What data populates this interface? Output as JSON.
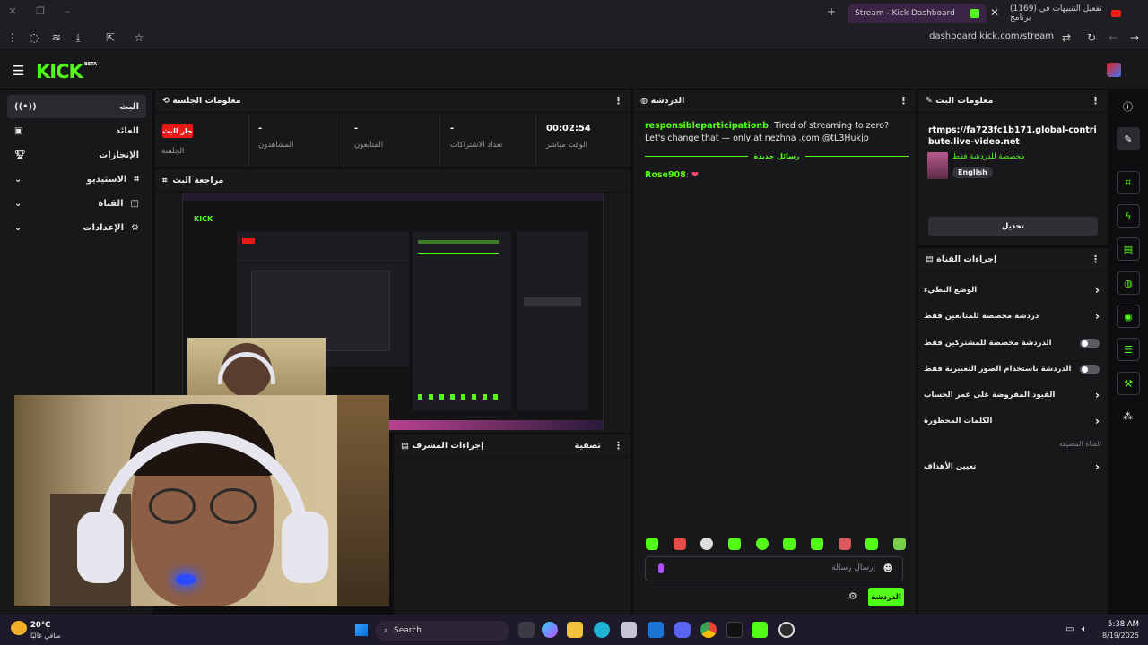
{
  "browser": {
    "tabs": [
      {
        "title": "(1169) تفعيل التنبيهات في برنامج",
        "active": false
      },
      {
        "title": "Stream - Kick Dashboard",
        "active": true
      }
    ],
    "url": "dashboard.kick.com/stream"
  },
  "app": {
    "logo": "KICK",
    "beta": "BETA"
  },
  "nav": [
    {
      "label": "البث",
      "icon": "broadcast-icon",
      "active": true
    },
    {
      "label": "العائد",
      "icon": "money-icon",
      "active": false
    },
    {
      "label": "الإنجازات",
      "icon": "trophy-icon",
      "active": false
    },
    {
      "label": "الاستيديو",
      "icon": "studio-icon",
      "active": false
    },
    {
      "label": "القناة",
      "icon": "channel-icon",
      "active": false
    },
    {
      "label": "الإعدادات",
      "icon": "gear-icon",
      "active": false
    }
  ],
  "session": {
    "title": "معلومات الجلسة",
    "badge": "جار البث",
    "badge_label": "الجلسة",
    "stats": [
      {
        "value": "-",
        "label": "المشاهدون"
      },
      {
        "value": "-",
        "label": "المتابعون"
      },
      {
        "value": "-",
        "label": "تعداد الاشتراكات"
      },
      {
        "value": "00:02:54",
        "label": "الوقت مباشر"
      }
    ]
  },
  "preview": {
    "title": "مراجعة البث"
  },
  "chat": {
    "title": "الدردشة",
    "messages": [
      {
        "user": "responsibleparticipationb",
        "text": ": Tired of streaming to zero? Let's change that — only at nezhna .com @tL3Hukjp"
      },
      {
        "user": "Rose908",
        "text": ": ❤"
      }
    ],
    "separator": "رسائل جديدة",
    "placeholder": "إرسال رسالة",
    "send_label": "الدردشة"
  },
  "mod": {
    "title": "إجراءات المشرف",
    "filter": "تصفية"
  },
  "stream_info": {
    "title": "معلومات البث",
    "url": "rtmps://fa723fc1b171.global-contribute.live-video.net",
    "category": "مخصصة للدردشة فقط",
    "language": "English",
    "edit_label": "تحديل"
  },
  "channel_actions": {
    "title": "إجراءات القناة",
    "rows": [
      {
        "label": "الوضع البطيء",
        "control": "chevron"
      },
      {
        "label": "دردشة مخصصة للمتابعين فقط",
        "control": "chevron"
      },
      {
        "label": "الدردشة مخصصة للمشتركين فقط",
        "control": "toggle"
      },
      {
        "label": "الدردشة باستخدام الصور التعبيرية فقط",
        "control": "toggle"
      },
      {
        "label": "القيود المفروضة على عمر الحساب",
        "control": "chevron"
      },
      {
        "label": "الكلمات المحظورة",
        "control": "chevron"
      }
    ],
    "muted": "القناة المضيفة",
    "goals": "تعيين الأهداف"
  },
  "taskbar": {
    "weather_temp": "20°C",
    "weather_desc": "صافي غالبًا",
    "search": "Search",
    "time": "5:38 AM",
    "date": "8/19/2025"
  },
  "colors": {
    "accent": "#53fc18",
    "live": "#e91916",
    "panel": "#18181b",
    "bg": "#0e0e10"
  }
}
